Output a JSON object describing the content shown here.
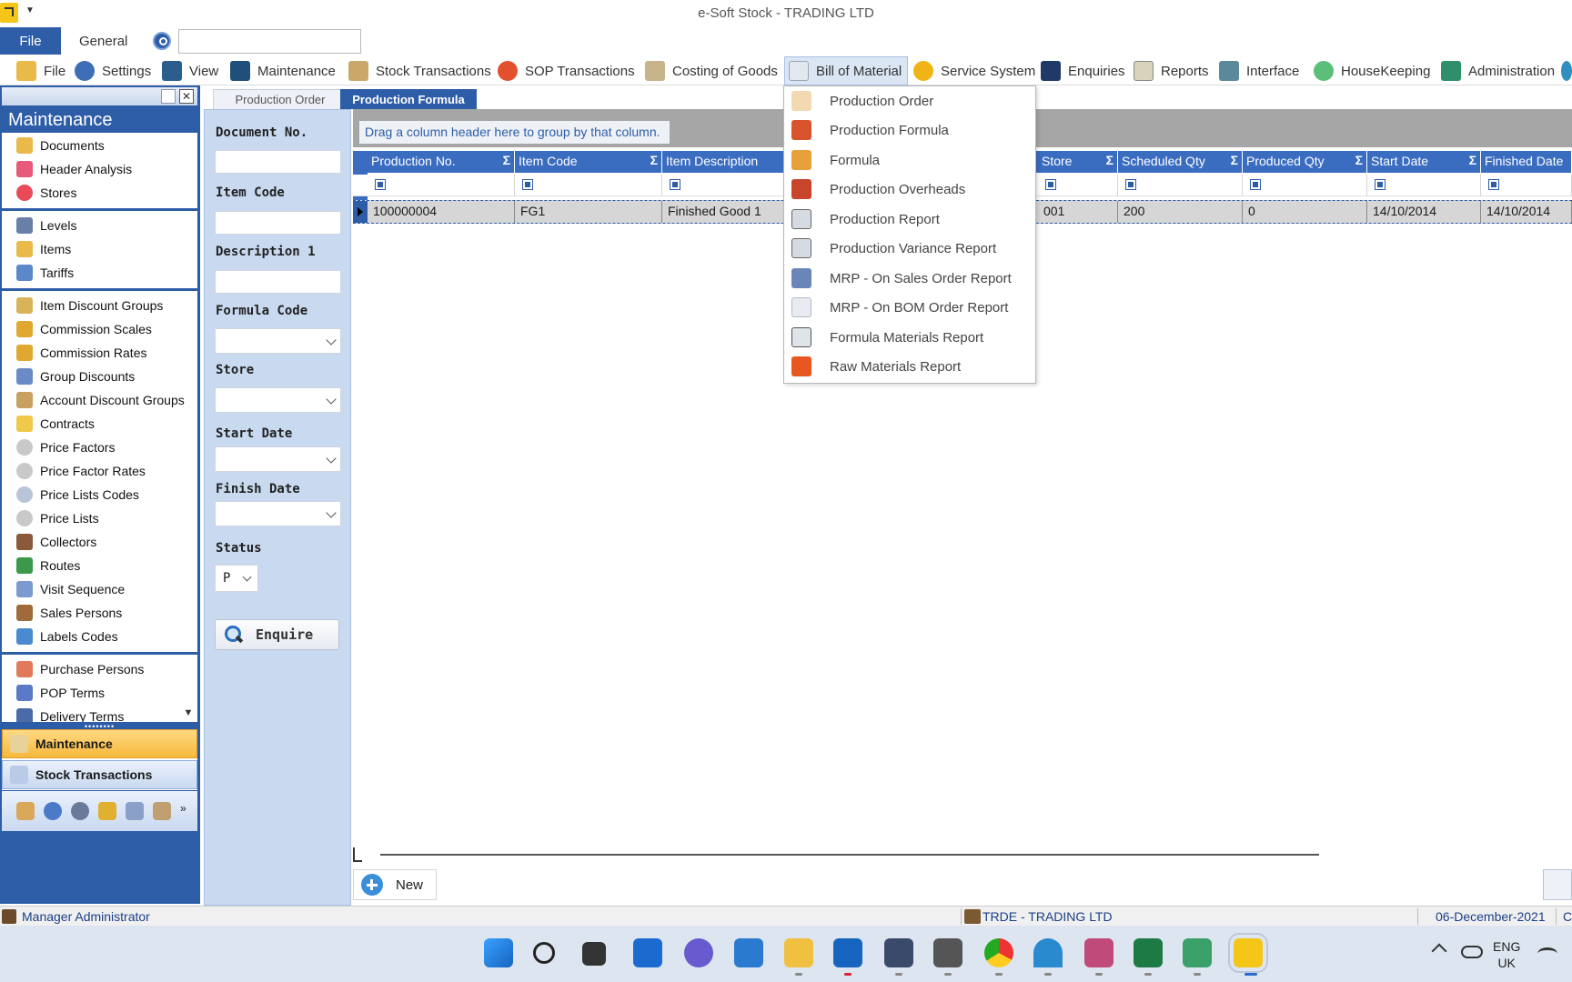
{
  "window": {
    "title": "e-Soft Stock - TRADING LTD"
  },
  "ribbon": {
    "file_tab": "File",
    "general_tab": "General",
    "search_value": ""
  },
  "menu": {
    "items": [
      "File",
      "Settings",
      "View",
      "Maintenance",
      "Stock Transactions",
      "SOP Transactions",
      "Costing of Goods",
      "Bill of Material",
      "Service System",
      "Enquiries",
      "Reports",
      "Interface",
      "HouseKeeping",
      "Administration"
    ],
    "active": "Bill of Material"
  },
  "sidebar": {
    "title": "Maintenance",
    "items": [
      "Documents",
      "Header Analysis",
      "Stores",
      "Levels",
      "Items",
      "Tariffs",
      "Item Discount Groups",
      "Commission Scales",
      "Commission Rates",
      "Group Discounts",
      "Account Discount Groups",
      "Contracts",
      "Price Factors",
      "Price Factor Rates",
      "Price Lists Codes",
      "Price Lists",
      "Collectors",
      "Routes",
      "Visit Sequence",
      "Sales Persons",
      "Labels Codes",
      "Purchase Persons",
      "POP Terms",
      "Delivery Terms"
    ],
    "groups": [
      "Maintenance",
      "Stock Transactions"
    ]
  },
  "tabs": [
    "Production Order",
    "Production Formula"
  ],
  "filters": {
    "document_no": "Document No.",
    "item_code": "Item Code",
    "description": "Description 1",
    "formula_code": "Formula Code",
    "store": "Store",
    "start_date": "Start Date",
    "finish_date": "Finish Date",
    "status": "Status",
    "status_value": "P",
    "enquire": "Enquire"
  },
  "grid": {
    "group_hint": "Drag a column header here to group by that column.",
    "columns": [
      "Production No.",
      "Item Code",
      "Item Description",
      "Store",
      "Scheduled Qty",
      "Produced Qty",
      "Start Date",
      "Finished Date"
    ],
    "row": [
      "100000004",
      "FG1",
      "Finished Good 1",
      "001",
      "200",
      "0",
      "14/10/2014",
      "14/10/2014"
    ]
  },
  "footer": {
    "new_label": "New"
  },
  "dropdown": {
    "items": [
      "Production Order",
      "Production Formula",
      "Formula",
      "Production Overheads",
      "Production Report",
      "Production Variance Report",
      "MRP - On Sales Order Report",
      "MRP - On BOM Order Report",
      "Formula Materials Report",
      "Raw Materials Report"
    ]
  },
  "statusbar": {
    "user": "Manager Administrator",
    "company": "TRDE - TRADING LTD",
    "date": "06-December-2021",
    "extra": "C"
  },
  "taskbar": {
    "lang_1": "ENG",
    "lang_2": "UK"
  }
}
